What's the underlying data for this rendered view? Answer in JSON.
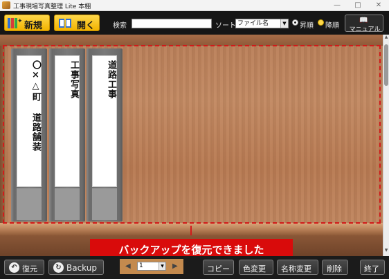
{
  "window": {
    "title": "工事現場写真整理 Lite 本棚",
    "minimize": "—",
    "maximize": "□",
    "close": "✕"
  },
  "toolbar": {
    "new_label": "新規",
    "open_label": "開く",
    "search_label": "検索",
    "search_value": "",
    "sort_label": "ソート",
    "sort_value": "ファイル名",
    "asc_label": "昇順",
    "desc_label": "降順",
    "manual_label": "マニュアル"
  },
  "binders": [
    {
      "title": "〇×△町 道路舗装"
    },
    {
      "title": "工事写真"
    },
    {
      "title": "道路工事"
    }
  ],
  "toast": {
    "message": "バックアップを復元できました"
  },
  "bottombar": {
    "restore_label": "復元",
    "backup_label": "Backup",
    "page_value": "1",
    "copy_label": "コピー",
    "color_label": "色変更",
    "rename_label": "名称変更",
    "delete_label": "削除",
    "exit_label": "終了"
  },
  "colors": {
    "accent_yellow": "#f2b300",
    "toast_red": "#d90b0b",
    "selection_red": "#d21a1a"
  }
}
